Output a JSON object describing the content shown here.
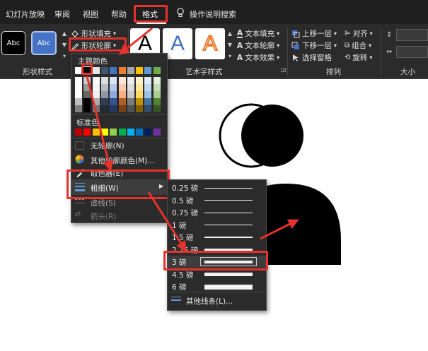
{
  "tabs": [
    "幻灯片放映",
    "审阅",
    "视图",
    "帮助",
    "格式"
  ],
  "tell_me": "操作说明搜索",
  "shape_styles": {
    "style_1_label": "Abc",
    "style_2_label": "Abc",
    "fill_label": "形状填充",
    "outline_label": "形状轮廓",
    "group_label": "形状样式"
  },
  "wordart": {
    "letter": "A",
    "text_fill": "文本填充",
    "text_outline": "文本轮廓",
    "text_effects": "文本效果",
    "group_label": "艺术字样式"
  },
  "arrange": {
    "bring_forward": "上移一层",
    "send_backward": "下移一层",
    "selection_pane": "选择窗格",
    "align": "对齐",
    "group": "组合",
    "rotate": "旋转",
    "group_label": "排列"
  },
  "size_label": "大小",
  "outline_menu": {
    "theme_colors_label": "主题颜色",
    "standard_colors_label": "标准色",
    "no_outline": "无轮廓(N)",
    "more_colors": "其他轮廓颜色(M)...",
    "eyedropper": "取色器(E)",
    "weight": "粗细(W)",
    "dashes": "虚线(S)",
    "arrows": "箭头(R)",
    "theme_top_row": [
      "#ffffff",
      "#000000",
      "#e7e6e6",
      "#44546a",
      "#4472c4",
      "#ed7d31",
      "#a5a5a5",
      "#ffc000",
      "#5b9bd5",
      "#70ad47"
    ],
    "standard_colors": [
      "#c00000",
      "#ff0000",
      "#ffc000",
      "#ffff00",
      "#92d050",
      "#00b050",
      "#00b0f0",
      "#0070c0",
      "#002060",
      "#7030a0"
    ]
  },
  "weight_menu": {
    "items": [
      "0.25 磅",
      "0.5 磅",
      "0.75 磅",
      "1 磅",
      "1.5 磅",
      "2.25 磅",
      "3 磅",
      "4.5 磅",
      "6 磅"
    ],
    "weights_pt": [
      0.25,
      0.5,
      0.75,
      1,
      1.5,
      2.25,
      3,
      4.5,
      6
    ],
    "selected": "3 磅",
    "more_lines": "其他线条(L)..."
  },
  "colors": {
    "highlight": "#e5322d",
    "ribbon_bg": "#2b2b2b",
    "tab_bg": "#1f1f1f"
  }
}
